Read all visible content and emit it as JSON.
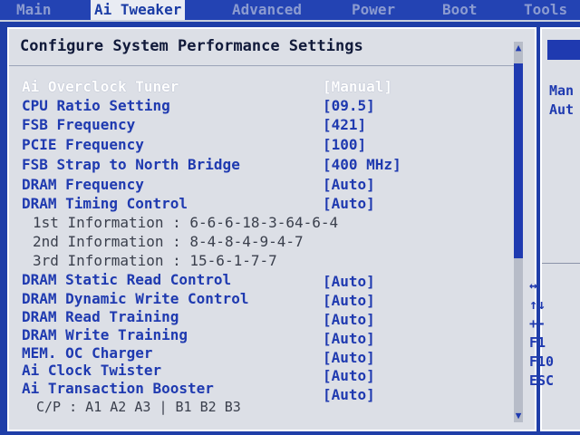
{
  "tabs": [
    {
      "label": "Main",
      "active": false
    },
    {
      "label": "Ai Tweaker",
      "active": true
    },
    {
      "label": "Advanced",
      "active": false
    },
    {
      "label": "Power",
      "active": false
    },
    {
      "label": "Boot",
      "active": false
    },
    {
      "label": "Tools",
      "active": false
    }
  ],
  "panel_title": "Configure System Performance Settings",
  "settings": [
    {
      "label": "Ai Overclock Tuner",
      "value": "[Manual]"
    },
    {
      "label": "CPU Ratio Setting",
      "value": "[09.5]"
    },
    {
      "label": "FSB Frequency",
      "value": "[421]"
    },
    {
      "label": "PCIE Frequency",
      "value": "[100]"
    },
    {
      "label": "FSB Strap to North Bridge",
      "value": "[400 MHz]"
    },
    {
      "label": "DRAM Frequency",
      "value": "[Auto]"
    },
    {
      "label": "DRAM Timing Control",
      "value": "[Auto]"
    }
  ],
  "timing_info": [
    {
      "label": "1st Information",
      "value": "6-6-6-18-3-64-6-4"
    },
    {
      "label": "2nd Information",
      "value": "8-4-8-4-9-4-7"
    },
    {
      "label": "3rd Information",
      "value": "15-6-1-7-7"
    }
  ],
  "settings2": [
    {
      "label": "DRAM Static Read Control",
      "value": "[Auto]"
    },
    {
      "label": "DRAM Dynamic Write Control",
      "value": "[Auto]"
    },
    {
      "label": "DRAM Read Training",
      "value": "[Auto]"
    },
    {
      "label": "DRAM Write Training",
      "value": "[Auto]"
    },
    {
      "label": "MEM. OC Charger",
      "value": "[Auto]"
    },
    {
      "label": "Ai Clock Twister",
      "value": "[Auto]"
    },
    {
      "label": "Ai Transaction Booster",
      "value": "[Auto]"
    }
  ],
  "cp_line": "C/P : A1 A2 A3 | B1 B2 B3",
  "help_lines": [
    "Man",
    "Aut"
  ],
  "keys": [
    "↔",
    "↑↓",
    "+-",
    "F1",
    "F10",
    "ESC"
  ],
  "scroll_up_icon": "▲",
  "scroll_down_icon": "▼",
  "colors": {
    "background": "#1f3ea8",
    "panel": "#dcdfe6",
    "item": "#1f3ab0",
    "highlight": "#ffffff"
  }
}
